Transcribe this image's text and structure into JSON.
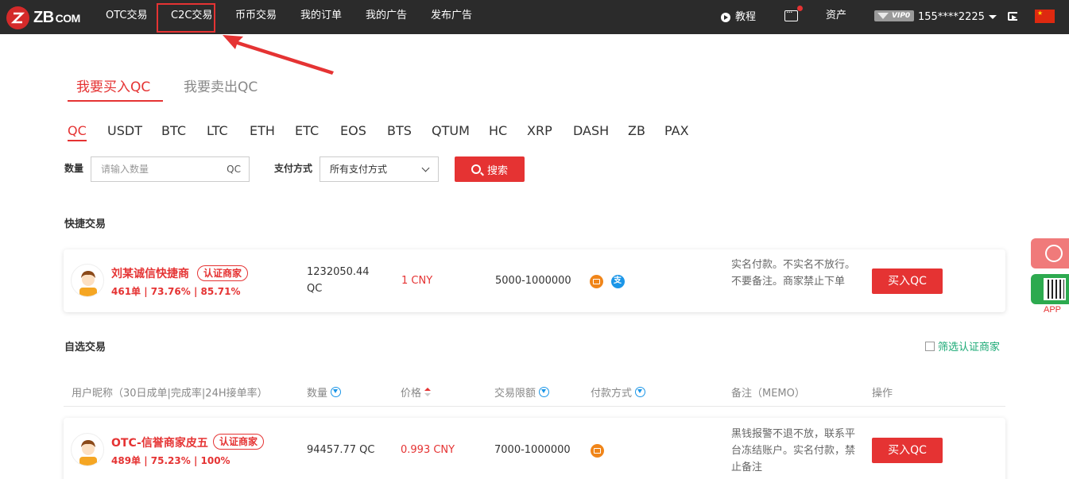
{
  "nav": {
    "logo_text": "ZB",
    "logo_suffix": "COM",
    "items": [
      "OTC交易",
      "C2C交易",
      "币币交易",
      "我的订单",
      "我的广告",
      "发布广告"
    ],
    "tutorial": "教程",
    "assets": "资产",
    "vip_label": "VIP0",
    "user_phone": "155****2225",
    "highlighted_item": "C2C交易"
  },
  "trade_tabs": [
    "我要买入QC",
    "我要卖出QC"
  ],
  "active_trade_tab": "我要买入QC",
  "coins": [
    "QC",
    "USDT",
    "BTC",
    "LTC",
    "ETH",
    "ETC",
    "EOS",
    "BTS",
    "QTUM",
    "HC",
    "XRP",
    "DASH",
    "ZB",
    "PAX"
  ],
  "active_coin": "QC",
  "filters": {
    "quantity_label": "数量",
    "quantity_placeholder": "请输入数量",
    "quantity_unit": "QC",
    "payment_label": "支付方式",
    "payment_value": "所有支付方式",
    "search_button": "搜索"
  },
  "quick_trade": {
    "section_title": "快捷交易",
    "merchant": "刘某诚信快捷商",
    "badge": "认证商家",
    "stats": "461单 | 73.76% | 85.71%",
    "quantity": "1232050.44",
    "quantity_unit": "QC",
    "price": "1 CNY",
    "limit": "5000-1000000",
    "payments": [
      "bank-card",
      "alipay"
    ],
    "memo": "实名付款。不实名不放行。不要备注。商家禁止下单",
    "buy_button": "买入QC"
  },
  "self_select": {
    "section_title": "自选交易",
    "verified_filter": "筛选认证商家",
    "columns": [
      "用户昵称（30日成单|完成率|24H接单率）",
      "数量",
      "价格",
      "交易限额",
      "付款方式",
      "备注（MEMO）",
      "操作"
    ],
    "rows": [
      {
        "merchant": "OTC-信誉商家皮五",
        "badge": "认证商家",
        "stats": "489单 | 75.23% | 100%",
        "quantity": "94457.77 QC",
        "price": "0.993 CNY",
        "limit": "7000-1000000",
        "payments": [
          "bank-card"
        ],
        "memo": "黑钱报警不退不放，联系平台冻结账户。实名付款，禁止备注",
        "buy_button": "买入QC"
      }
    ]
  },
  "side": {
    "app_label": "APP"
  },
  "colors": {
    "accent": "#e53333",
    "topbar": "#2b2b2b",
    "verified_green": "#19a974",
    "filter_blue": "#1b96e8"
  }
}
